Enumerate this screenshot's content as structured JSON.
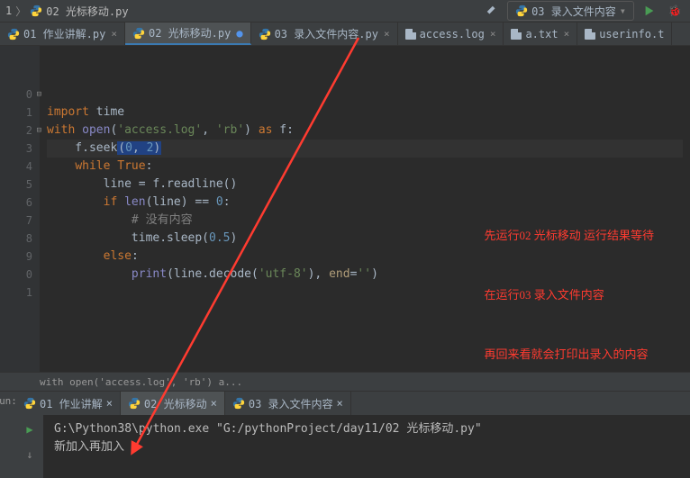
{
  "breadcrumb": {
    "folder": "1",
    "file": "02 光标移动.py"
  },
  "toolbar": {
    "run_config": "03 录入文件内容"
  },
  "tabs": [
    {
      "label": "01 作业讲解.py",
      "active": false,
      "type": "py"
    },
    {
      "label": "02 光标移动.py",
      "active": true,
      "type": "py",
      "modified": true
    },
    {
      "label": "03 录入文件内容.py",
      "active": false,
      "type": "py"
    },
    {
      "label": "access.log",
      "active": false,
      "type": "txt"
    },
    {
      "label": "a.txt",
      "active": false,
      "type": "txt"
    },
    {
      "label": "userinfo.t",
      "active": false,
      "type": "txt",
      "noclose": true
    }
  ],
  "line_numbers": [
    "",
    "",
    "0",
    "1",
    "2",
    "3",
    "4",
    "5",
    "6",
    "7",
    "8",
    "9",
    "0",
    "1"
  ],
  "code_lines": [
    {
      "html": ""
    },
    {
      "html": "<span class='kw'>import</span> time"
    },
    {
      "html": "<span class='kw'>with</span> <span class='builtin'>open</span>(<span class='str'>'access.log'</span>, <span class='str'>'rb'</span>) <span class='kw'>as</span> f:"
    },
    {
      "html": "    f.seek<span class='caret-bg'>(<span class='num'>0</span>, <span class='num'>2</span>)</span>",
      "hl": true
    },
    {
      "html": "    <span class='kw'>while True</span>:"
    },
    {
      "html": "        line = f.readline()"
    },
    {
      "html": "        <span class='kw'>if </span><span class='builtin'>len</span>(line) == <span class='num'>0</span>:"
    },
    {
      "html": "            <span class='cmt'># 没有内容</span>"
    },
    {
      "html": "            time.sleep(<span class='num'>0.5</span>)"
    },
    {
      "html": "        <span class='kw'>else</span>:"
    },
    {
      "html": "            <span class='builtin'>print</span>(line.decode(<span class='str'>'utf-8'</span>), <span class='fn'>end</span>=<span class='str'>''</span>)"
    },
    {
      "html": ""
    },
    {
      "html": ""
    },
    {
      "html": ""
    }
  ],
  "annotation": {
    "l1": "先运行02 光标移动 运行结果等待",
    "l2": "在运行03 录入文件内容",
    "l3": "再回来看就会打印出录入的内容"
  },
  "breadcrumb_bottom": "with open('access.log', 'rb') a...",
  "run_label": "un:",
  "run_tabs": [
    {
      "label": "01 作业讲解",
      "active": false
    },
    {
      "label": "02 光标移动",
      "active": true
    },
    {
      "label": "03 录入文件内容",
      "active": false
    }
  ],
  "console": {
    "cmd": "G:\\Python38\\python.exe \"G:/pythonProject/day11/02 光标移动.py\"",
    "out": "新加入再加入"
  }
}
